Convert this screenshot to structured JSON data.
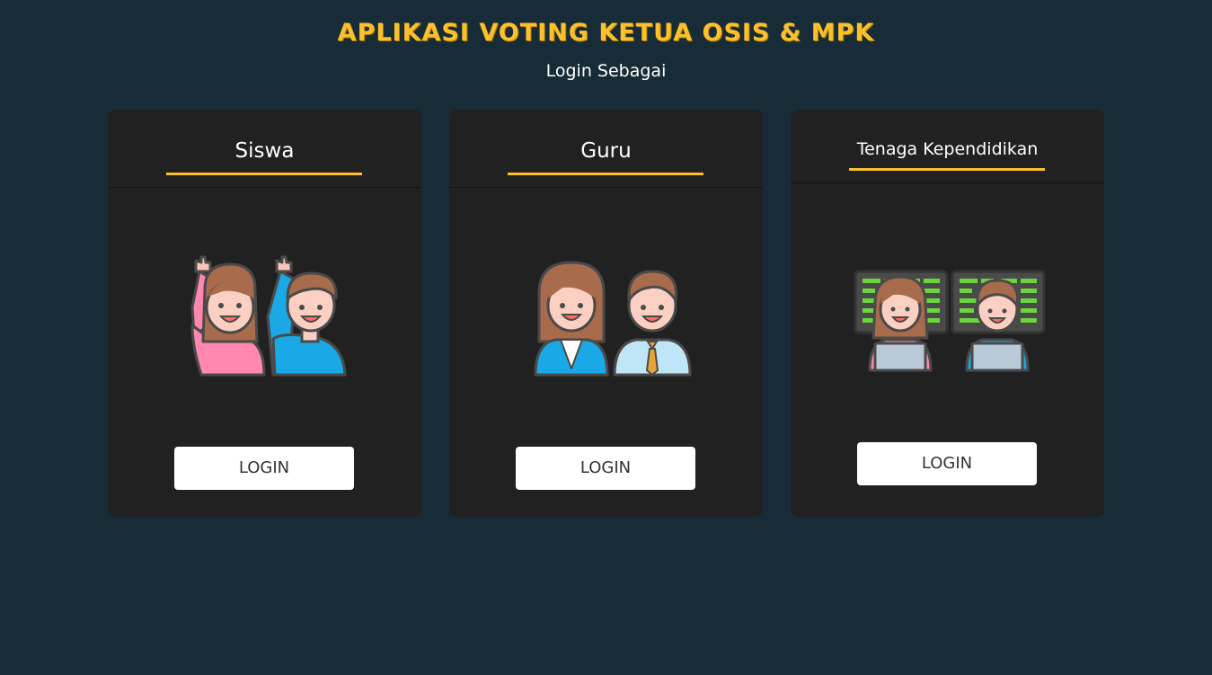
{
  "header": {
    "title": "Aplikasi Voting Ketua OSIS & MPK",
    "subtitle": "Login Sebagai"
  },
  "cards": [
    {
      "title": "Siswa",
      "button_label": "LOGIN"
    },
    {
      "title": "Guru",
      "button_label": "LOGIN"
    },
    {
      "title": "Tenaga Kependidikan",
      "button_label": "LOGIN"
    }
  ],
  "theme": {
    "background": "#172c36",
    "card": "#212121",
    "accent": "#fbc02d",
    "button": "#ffffff"
  }
}
